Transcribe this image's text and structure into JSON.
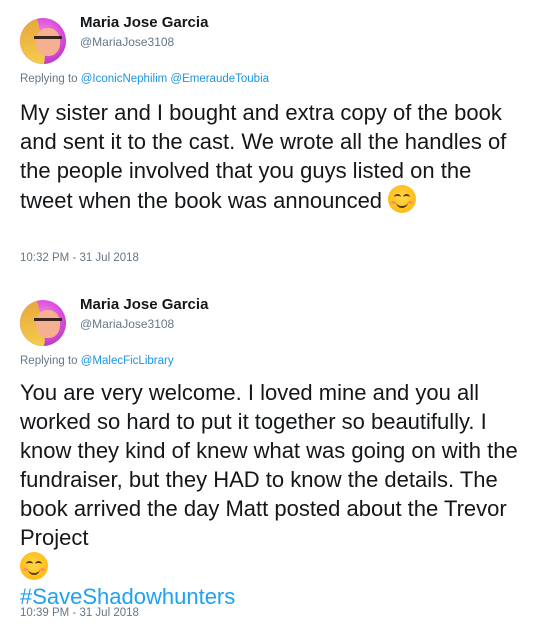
{
  "tweets": [
    {
      "author": {
        "name": "Maria Jose Garcia",
        "handle": "@MariaJose3108"
      },
      "replying_prefix": "Replying to",
      "replying_to": [
        "@IconicNephilim",
        "@EmeraudeToubia"
      ],
      "text": "My sister and I bought and extra copy of the book and sent it to the cast. We wrote all the handles of the people involved that you guys listed on the tweet when the book was announced",
      "emoji": "smiling-face-icon",
      "timestamp": "10:32 PM - 31 Jul 2018"
    },
    {
      "author": {
        "name": "Maria Jose Garcia",
        "handle": "@MariaJose3108"
      },
      "replying_prefix": "Replying to",
      "replying_to": [
        "@MalecFicLibrary"
      ],
      "text": "You are very welcome. I loved mine and you all worked so hard to put it together so beautifully. I know they kind of knew what was going on with the fundraiser, but they HAD to know the details. The book arrived the day Matt posted about the Trevor Project",
      "emoji": "smiling-face-icon",
      "hashtag": "#SaveShadowhunters",
      "timestamp": "10:39 PM - 31 Jul 2018"
    }
  ],
  "colors": {
    "link": "#1b95e0",
    "hashtag": "#1da1f2",
    "meta": "#657786",
    "text": "#14171a"
  }
}
